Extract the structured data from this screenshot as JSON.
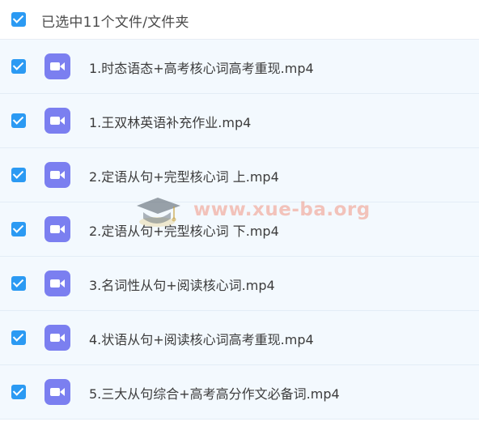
{
  "header": {
    "checked": true,
    "selection_text": "已选中11个文件/文件夹"
  },
  "files": [
    {
      "name": "1.时态语态+高考核心词高考重现.mp4",
      "checked": true,
      "icon": "video-icon"
    },
    {
      "name": "1.王双林英语补充作业.mp4",
      "checked": true,
      "icon": "video-icon"
    },
    {
      "name": "2.定语从句+完型核心词 上.mp4",
      "checked": true,
      "icon": "video-icon"
    },
    {
      "name": "2.定语从句+完型核心词 下.mp4",
      "checked": true,
      "icon": "video-icon"
    },
    {
      "name": "3.名词性从句+阅读核心词.mp4",
      "checked": true,
      "icon": "video-icon"
    },
    {
      "name": "4.状语从句+阅读核心词高考重现.mp4",
      "checked": true,
      "icon": "video-icon"
    },
    {
      "name": "5.三大从句综合+高考高分作文必备词.mp4",
      "checked": true,
      "icon": "video-icon"
    }
  ],
  "watermark": {
    "text": "www.xue-ba.org"
  },
  "colors": {
    "checkbox": "#2b9af3",
    "video_icon": "#7b7ff0",
    "row_background": "#f3f9fe"
  }
}
